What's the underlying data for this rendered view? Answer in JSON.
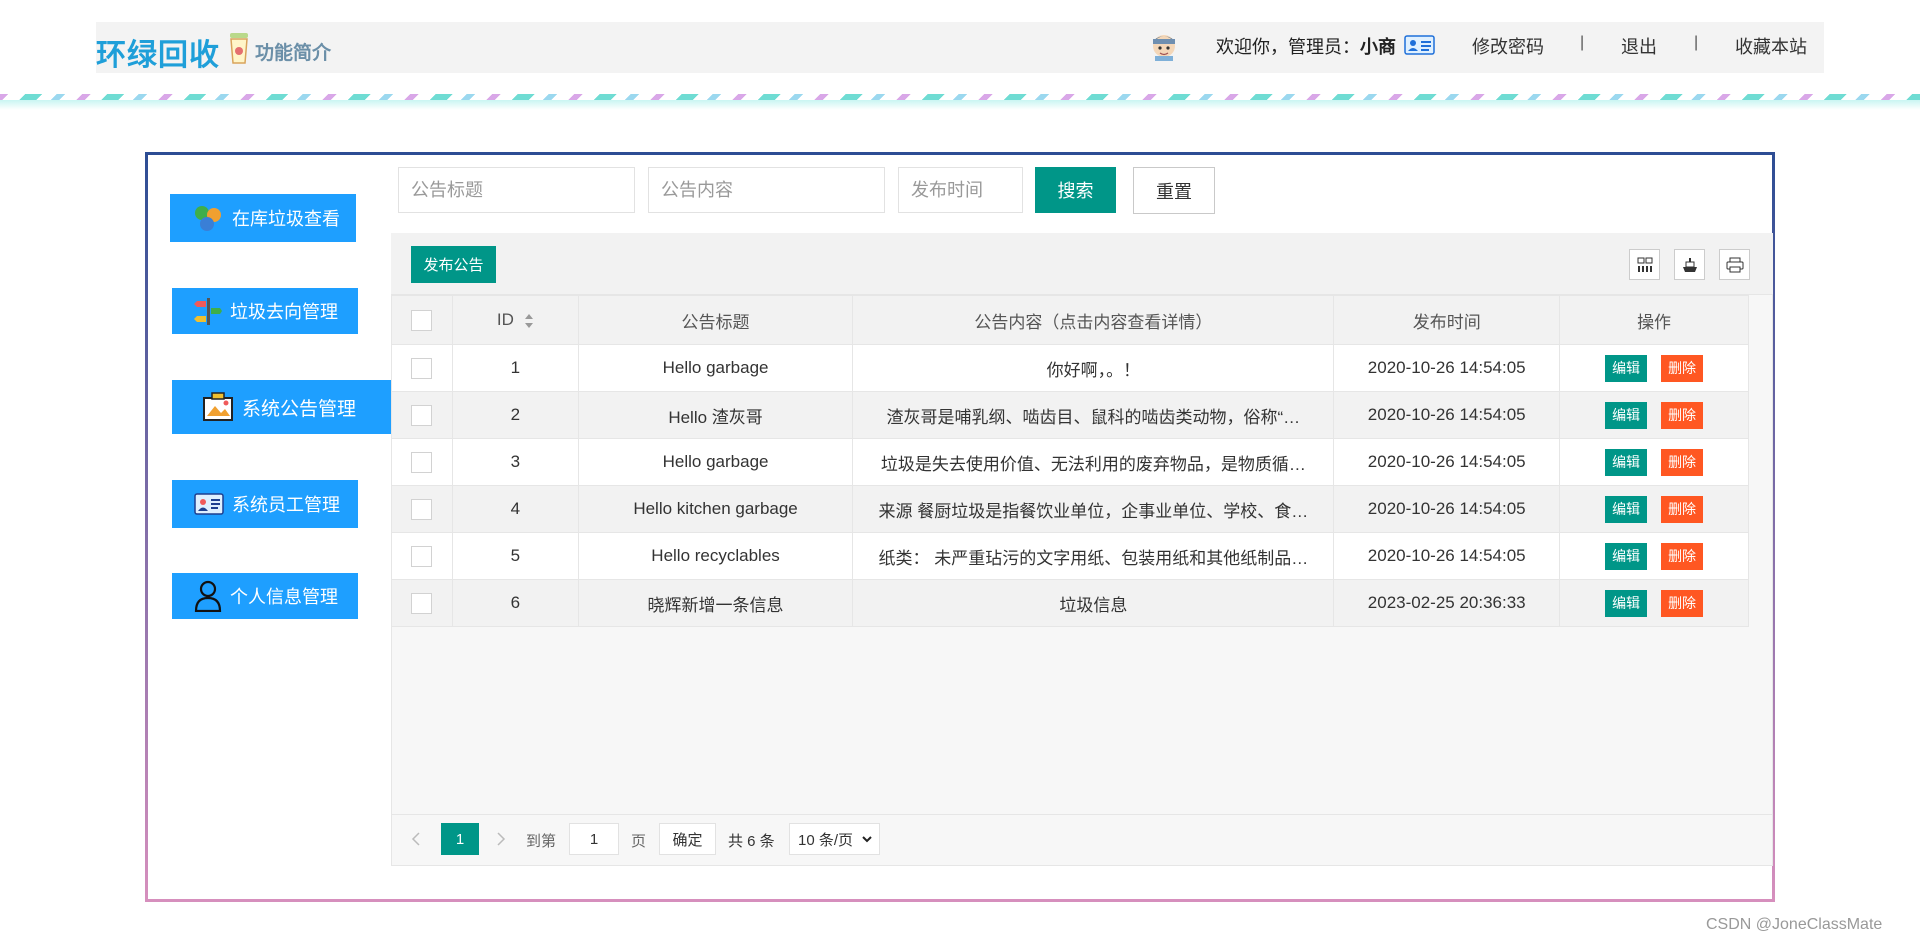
{
  "header": {
    "logo": "环绿回收",
    "intro": "功能简介",
    "welcome_prefix": "欢迎你，管理员：",
    "username": "小商",
    "change_password": "修改密码",
    "logout": "退出",
    "bookmark": "收藏本站",
    "separator": "|"
  },
  "sidebar": {
    "items": [
      {
        "label": "在库垃圾查看",
        "icon": "recycle-icon"
      },
      {
        "label": "垃圾去向管理",
        "icon": "signpost-icon"
      },
      {
        "label": "系统公告管理",
        "icon": "notice-board-icon"
      },
      {
        "label": "系统员工管理",
        "icon": "id-card-icon"
      },
      {
        "label": "个人信息管理",
        "icon": "user-icon"
      }
    ]
  },
  "search": {
    "title_placeholder": "公告标题",
    "content_placeholder": "公告内容",
    "time_placeholder": "发布时间",
    "search_label": "搜索",
    "reset_label": "重置"
  },
  "toolbar": {
    "publish_label": "发布公告",
    "icons": [
      "columns-icon",
      "export-icon",
      "print-icon"
    ]
  },
  "table": {
    "headers": [
      "ID",
      "公告标题",
      "公告内容（点击内容查看详情）",
      "发布时间",
      "操作"
    ],
    "edit_label": "编辑",
    "delete_label": "删除",
    "rows": [
      {
        "id": "1",
        "title": "Hello garbage",
        "content": "你好啊，。！",
        "time": "2020-10-26 14:54:05"
      },
      {
        "id": "2",
        "title": "Hello 渣灰哥",
        "content": "渣灰哥是哺乳纲、啮齿目、鼠科的啮齿类动物，俗称“…",
        "time": "2020-10-26 14:54:05"
      },
      {
        "id": "3",
        "title": "Hello garbage",
        "content": "垃圾是失去使用价值、无法利用的废弃物品，是物质循…",
        "time": "2020-10-26 14:54:05"
      },
      {
        "id": "4",
        "title": "Hello kitchen garbage",
        "content": "来源 餐厨垃圾是指餐饮业单位，企事业单位、学校、食…",
        "time": "2020-10-26 14:54:05"
      },
      {
        "id": "5",
        "title": "Hello recyclables",
        "content": "纸类： 未严重玷污的文字用纸、包装用纸和其他纸制品…",
        "time": "2020-10-26 14:54:05"
      },
      {
        "id": "6",
        "title": "晓辉新增一条信息",
        "content": "垃圾信息",
        "time": "2023-02-25 20:36:33"
      }
    ]
  },
  "pagination": {
    "current_page": "1",
    "goto_label": "到第",
    "page_input": "1",
    "page_unit": "页",
    "confirm_label": "确定",
    "total_label": "共 6 条",
    "page_size": "10 条/页"
  },
  "watermark": "CSDN @JoneClassMate",
  "colors": {
    "primary_teal": "#009688",
    "sidebar_blue": "#1e9fff",
    "danger_orange": "#ff5722",
    "logo_blue": "#1f9fd9"
  }
}
